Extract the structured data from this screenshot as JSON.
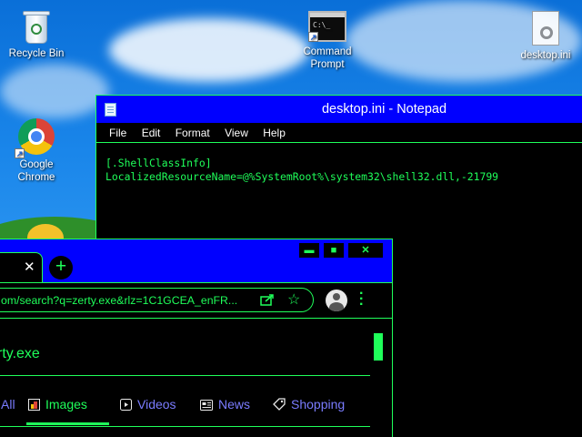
{
  "desktop": {
    "icons": [
      {
        "label": "Recycle Bin"
      },
      {
        "label": "Command Prompt"
      },
      {
        "label": "desktop.ini"
      },
      {
        "label": "Google Chrome"
      }
    ],
    "cmd_glyph_text": "C:\\_"
  },
  "notepad": {
    "title": "desktop.ini - Notepad",
    "menu": [
      "File",
      "Edit",
      "Format",
      "View",
      "Help"
    ],
    "content_lines": [
      "[.ShellClassInfo]",
      "LocalizedResourceName=@%SystemRoot%\\system32\\shell32.dll,-21799"
    ]
  },
  "chrome": {
    "tab_close": "✕",
    "new_tab": "+",
    "window_buttons": {
      "minimize": "▬",
      "maximize": "■",
      "close": "✕"
    },
    "url": "om/search?q=zerty.exe&rlz=1C1GCEA_enFR...",
    "query_text": "rty.exe",
    "filters": [
      {
        "label": "All",
        "icon": "none",
        "active": false
      },
      {
        "label": "Images",
        "icon": "image-icon",
        "active": true
      },
      {
        "label": "Videos",
        "icon": "video-icon",
        "active": false
      },
      {
        "label": "News",
        "icon": "news-icon",
        "active": false
      },
      {
        "label": "Shopping",
        "icon": "tag-icon",
        "active": false
      }
    ],
    "colors": {
      "accent": "#1fff5a",
      "titlebar": "#0000ff",
      "inactive_filter": "#7a7cff"
    }
  }
}
